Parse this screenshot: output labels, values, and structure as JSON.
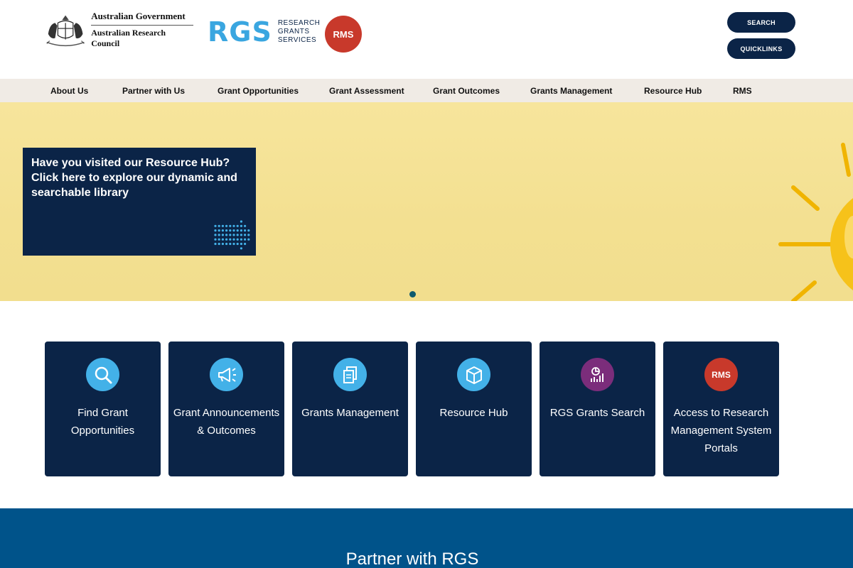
{
  "header": {
    "gov_line1": "Australian Government",
    "gov_line2": "Australian Research Council",
    "rgs_mark": "RGS",
    "rgs_words": [
      "RESEARCH",
      "GRANTS",
      "SERVICES"
    ],
    "rms_badge": "RMS",
    "search_label": "SEARCH",
    "quicklinks_label": "QUICKLINKS"
  },
  "nav": {
    "items": [
      "About Us",
      "Partner with Us",
      "Grant Opportunities",
      "Grant Assessment",
      "Grant Outcomes",
      "Grants Management",
      "Resource Hub",
      "RMS"
    ]
  },
  "hero": {
    "line1": "Have you visited our Resource Hub?",
    "line2": "Click here to explore our dynamic and",
    "line3": "searchable library",
    "slide_index": 1,
    "slide_count": 1
  },
  "tiles": [
    {
      "line1": "Find Grant",
      "line2": "Opportunities",
      "line3": "",
      "icon": "search-icon"
    },
    {
      "line1": "Grant Announcements",
      "line2": "& Outcomes",
      "line3": "",
      "icon": "megaphone-icon"
    },
    {
      "line1": "Grants Management",
      "line2": "",
      "line3": "",
      "icon": "documents-icon"
    },
    {
      "line1": "Resource Hub",
      "line2": "",
      "line3": "",
      "icon": "box-icon"
    },
    {
      "line1": "RGS Grants Search",
      "line2": "",
      "line3": "",
      "icon": "analytics-icon"
    },
    {
      "line1": "Access to Research",
      "line2": "Management System",
      "line3": "Portals",
      "icon": "rms-badge",
      "badge": "RMS"
    }
  ],
  "partner": {
    "title": "Partner with RGS"
  },
  "colors": {
    "navy": "#0b2447",
    "accent_blue": "#43b1e8",
    "rms_red": "#c8392b",
    "purple": "#7b2d7b",
    "partner_blue": "#00538a",
    "hero_yellow": "#f3e091"
  }
}
